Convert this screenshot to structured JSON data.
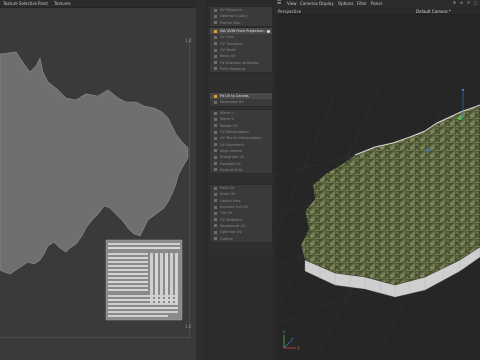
{
  "uv_editor": {
    "menu": [
      {
        "label": "Texture Selection"
      },
      {
        "label": "Paint"
      },
      {
        "label": "Textures"
      }
    ],
    "corner_labels": {
      "top_right": "1,0",
      "bottom_right": "1,0"
    }
  },
  "command_panel": {
    "sections": [
      {
        "items": [
          {
            "label": "UV Polygons",
            "active": false
          },
          {
            "label": "Optimal (Cubic)",
            "active": false
          },
          {
            "label": "Frontal Map",
            "active": false
          }
        ]
      },
      {
        "items": [
          {
            "label": "Set UVW From Projection...",
            "active": true,
            "has_dot": true
          },
          {
            "label": "UV Grid",
            "active": false
          },
          {
            "label": "UV Transform",
            "active": false
          },
          {
            "label": "UV Mode",
            "active": false
          },
          {
            "label": "Relax UV",
            "active": false
          },
          {
            "label": "Fit Selection to Region",
            "active": false
          },
          {
            "label": "Point Mapping",
            "active": false
          }
        ]
      },
      {
        "items": [
          {
            "label": "Fit UV to Canvas",
            "active": true
          },
          {
            "label": "Normalize UV",
            "active": false
          }
        ]
      },
      {
        "items": [
          {
            "label": "Mirror U",
            "active": false
          },
          {
            "label": "Mirror V",
            "active": false
          },
          {
            "label": "Rotate UV",
            "active": false
          },
          {
            "label": "UV Manipulation",
            "active": false
          },
          {
            "label": "UV Terrain Manipulation",
            "active": false
          },
          {
            "label": "UV Alignment",
            "active": false
          },
          {
            "label": "Align Seams",
            "active": false
          },
          {
            "label": "Straighten UV",
            "active": false
          },
          {
            "label": "Equalize UV",
            "active": false
          },
          {
            "label": "Snap to Grid",
            "active": false
          }
        ]
      },
      {
        "items": [
          {
            "label": "Pack UV",
            "active": false
          },
          {
            "label": "Scale UV",
            "active": false
          },
          {
            "label": "Layout Sets",
            "active": false
          },
          {
            "label": "Equalize Cut UV",
            "active": false
          },
          {
            "label": "Tile UV",
            "active": false
          },
          {
            "label": "UV Statistics",
            "active": false
          },
          {
            "label": "Randomize UV",
            "active": false
          },
          {
            "label": "Optimize UV",
            "active": false
          },
          {
            "label": "Outline",
            "active": false
          }
        ]
      }
    ]
  },
  "viewport": {
    "menu": [
      {
        "label": "View"
      },
      {
        "label": "Cameras"
      },
      {
        "label": "Display"
      },
      {
        "label": "Options"
      },
      {
        "label": "Filter"
      },
      {
        "label": "Panel"
      }
    ],
    "camera_label": "Perspective",
    "default_camera": "Default Camera *",
    "icons": [
      "move-view-icon",
      "zoom-view-icon",
      "rotate-view-icon",
      "maximize-view-icon"
    ],
    "colors": {
      "terrain_dark": "#3f4a2c",
      "terrain_light": "#7d8458",
      "skirt": "#cfcfcf",
      "background": "#262626",
      "grid": "#3a3a3a"
    }
  },
  "axis_gizmo": {
    "x": "X",
    "y": "Y",
    "z": "Z"
  }
}
